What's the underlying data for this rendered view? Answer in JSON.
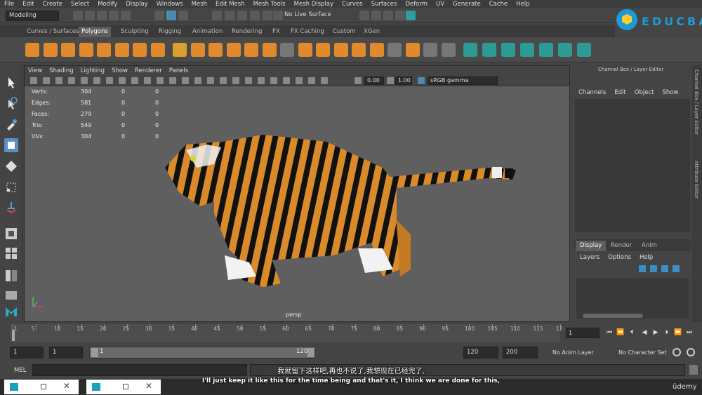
{
  "menubar": [
    "File",
    "Edit",
    "Create",
    "Select",
    "Modify",
    "Display",
    "Windows",
    "Mesh",
    "Edit Mesh",
    "Mesh Tools",
    "Mesh Display",
    "Curves",
    "Surfaces",
    "Deform",
    "UV",
    "Generate",
    "Cache",
    "Help"
  ],
  "status": {
    "mode": "Modeling",
    "live_surface": "No Live Surface"
  },
  "brand": {
    "text": "EDUCBA"
  },
  "shelf_tabs": [
    "Curves / Surfaces",
    "Polygons",
    "Sculpting",
    "Rigging",
    "Animation",
    "Rendering",
    "FX",
    "FX Caching",
    "Custom",
    "XGen"
  ],
  "shelf_active": "Polygons",
  "viewport": {
    "menu": [
      "View",
      "Shading",
      "Lighting",
      "Show",
      "Renderer",
      "Panels"
    ],
    "exposure": "0.00",
    "gamma": "1.00",
    "color_space": "sRGB gamma",
    "camera": "persp",
    "hud": [
      {
        "label": "Verts:",
        "a": "304",
        "b": "0",
        "c": "0"
      },
      {
        "label": "Edges:",
        "a": "581",
        "b": "0",
        "c": "0"
      },
      {
        "label": "Faces:",
        "a": "279",
        "b": "0",
        "c": "0"
      },
      {
        "label": "Tris:",
        "a": "549",
        "b": "0",
        "c": "0"
      },
      {
        "label": "UVs:",
        "a": "304",
        "b": "0",
        "c": "0"
      }
    ]
  },
  "channel_box": {
    "title": "Channel Box / Layer Editor",
    "menu": [
      "Channels",
      "Edit",
      "Object",
      "Show"
    ]
  },
  "layer_editor": {
    "tabs": [
      "Display",
      "Render",
      "Anim"
    ],
    "active": "Display",
    "menu": [
      "Layers",
      "Options",
      "Help"
    ]
  },
  "side_tabs": [
    "Channel Box / Layer Editor",
    "Attribute Editor"
  ],
  "timeline": {
    "ticks": [
      "1",
      "5",
      "10",
      "15",
      "20",
      "25",
      "30",
      "35",
      "40",
      "45",
      "50",
      "55",
      "60",
      "65",
      "70",
      "75",
      "80",
      "85",
      "90",
      "95",
      "100",
      "105",
      "110",
      "115",
      "12"
    ],
    "current": "1"
  },
  "range": {
    "start": "1",
    "start2": "1",
    "slider_start": "1",
    "slider_end": "120",
    "end": "120",
    "end2": "200",
    "anim_layer": "No Anim Layer",
    "char_set": "No Character Set"
  },
  "cmdline": {
    "label": "MEL"
  },
  "subtitles": {
    "zh": "我就留下这样吧,再也不说了,我想现在已经完了,",
    "en": "I'll just keep it like this for the time being and that's it, I think we are done for this,"
  },
  "watermark": "ûdemy",
  "colors": {
    "accent": "#5c8ec0",
    "shelf_orange": "#e08a2c",
    "shelf_teal": "#2c9b94"
  }
}
